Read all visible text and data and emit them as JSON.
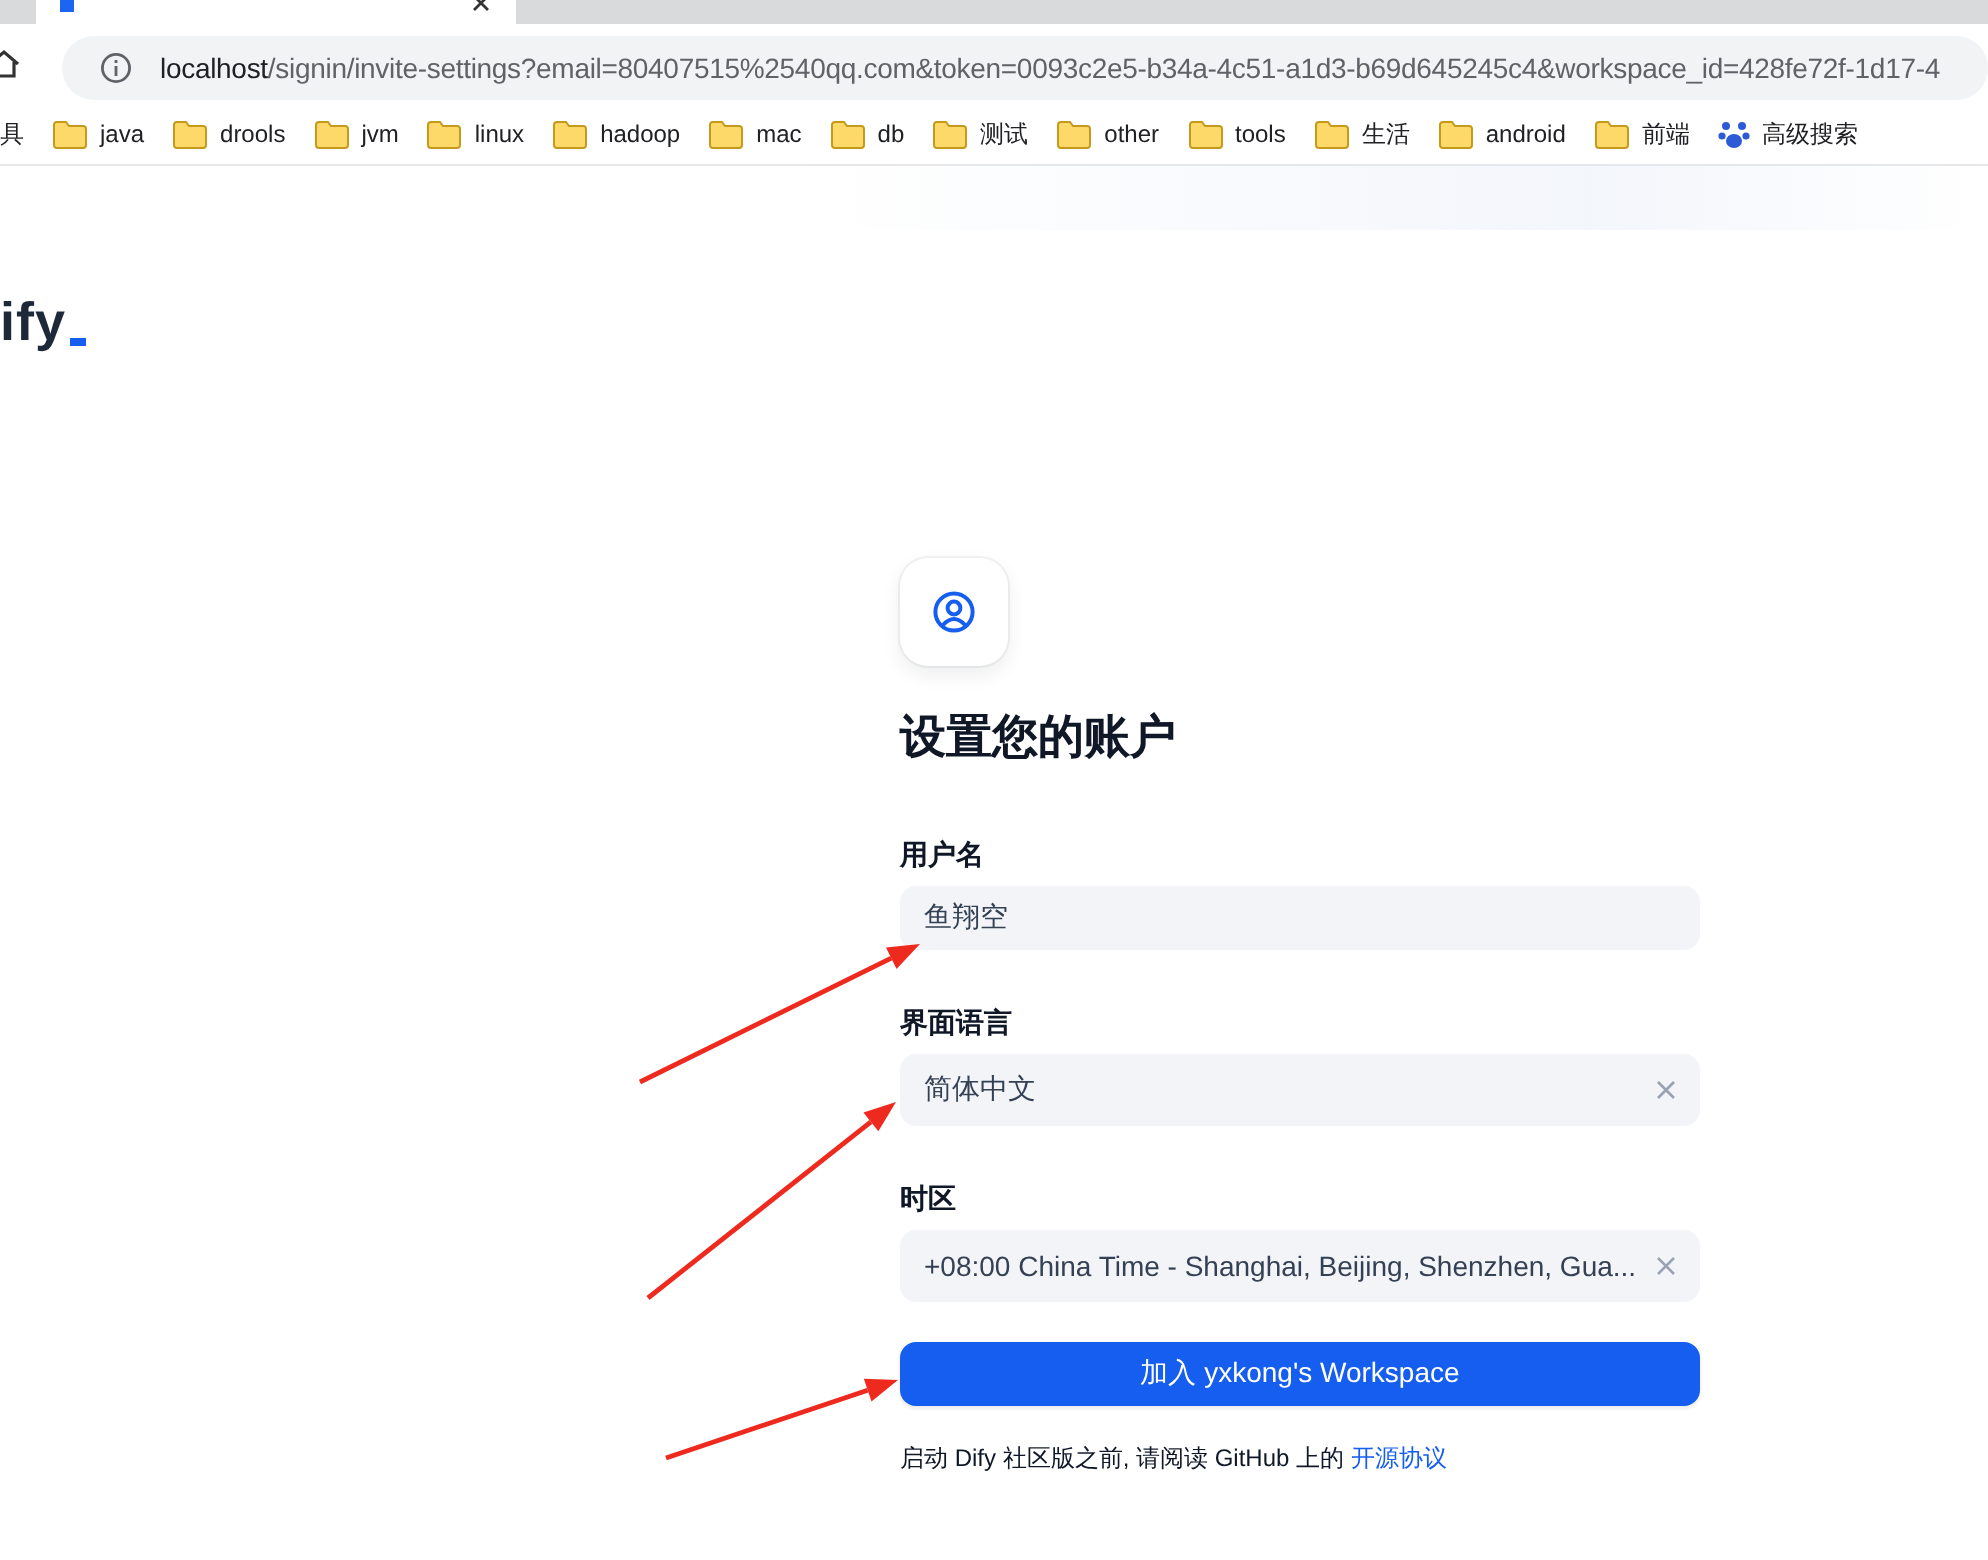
{
  "browser": {
    "url_host": "localhost",
    "url_path": "/signin/invite-settings?email=80407515%2540qq.com&token=0093c2e5-b34a-4c51-a1d3-b69d645245c4&workspace_id=428fe72f-1d17-4",
    "bookmarks": [
      {
        "kind": "text",
        "label": "具"
      },
      {
        "kind": "folder",
        "label": "java"
      },
      {
        "kind": "folder",
        "label": "drools"
      },
      {
        "kind": "folder",
        "label": "jvm"
      },
      {
        "kind": "folder",
        "label": "linux"
      },
      {
        "kind": "folder",
        "label": "hadoop"
      },
      {
        "kind": "folder",
        "label": "mac"
      },
      {
        "kind": "folder",
        "label": "db"
      },
      {
        "kind": "folder",
        "label": "测试"
      },
      {
        "kind": "folder",
        "label": "other"
      },
      {
        "kind": "folder",
        "label": "tools"
      },
      {
        "kind": "folder",
        "label": "生活"
      },
      {
        "kind": "folder",
        "label": "android"
      },
      {
        "kind": "folder",
        "label": "前端"
      },
      {
        "kind": "search",
        "label": "高级搜索"
      }
    ]
  },
  "logo": {
    "text": "ify"
  },
  "form": {
    "title": "设置您的账户",
    "fields": [
      {
        "kind": "input",
        "label": "用户名",
        "value": "鱼翔空",
        "clearable": false
      },
      {
        "kind": "select",
        "label": "界面语言",
        "value": "简体中文",
        "clearable": true
      },
      {
        "kind": "select",
        "label": "时区",
        "value": "+08:00 China Time - Shanghai, Beijing, Shenzhen, Gua...",
        "clearable": true
      }
    ],
    "submit": "加入 yxkong's Workspace",
    "footer": {
      "text": "启动 Dify 社区版之前, 请阅读 GitHub 上的 ",
      "link": "开源协议"
    }
  }
}
